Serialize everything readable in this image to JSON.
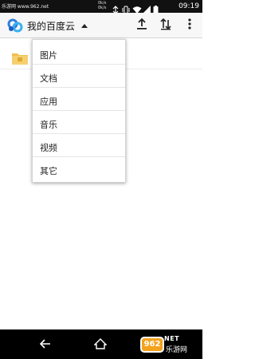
{
  "status_bar": {
    "watermark": "乐游网 www.962.net",
    "net_up": "0k/s",
    "net_down": "0k/s",
    "time": "09:19",
    "icons": [
      "sync-icon",
      "vibrate-icon",
      "wifi-icon",
      "signal-icon",
      "battery-icon"
    ]
  },
  "app_bar": {
    "title": "我的百度云",
    "actions": [
      "upload-icon",
      "sort-icon",
      "more-vert-icon"
    ]
  },
  "menu": {
    "items": [
      {
        "label": "图片"
      },
      {
        "label": "文档"
      },
      {
        "label": "应用"
      },
      {
        "label": "音乐"
      },
      {
        "label": "视频"
      },
      {
        "label": "其它"
      }
    ]
  },
  "nav_bar": {
    "brand_badge": "962",
    "brand_suffix": "NET",
    "brand_text": "乐游网"
  },
  "colors": {
    "status_bar_bg": "#111111",
    "app_bar_bg": "#f7f7f7",
    "nav_bar_bg": "#000000",
    "folder": "#f0c050",
    "brand_orange": "#f2a21d"
  }
}
